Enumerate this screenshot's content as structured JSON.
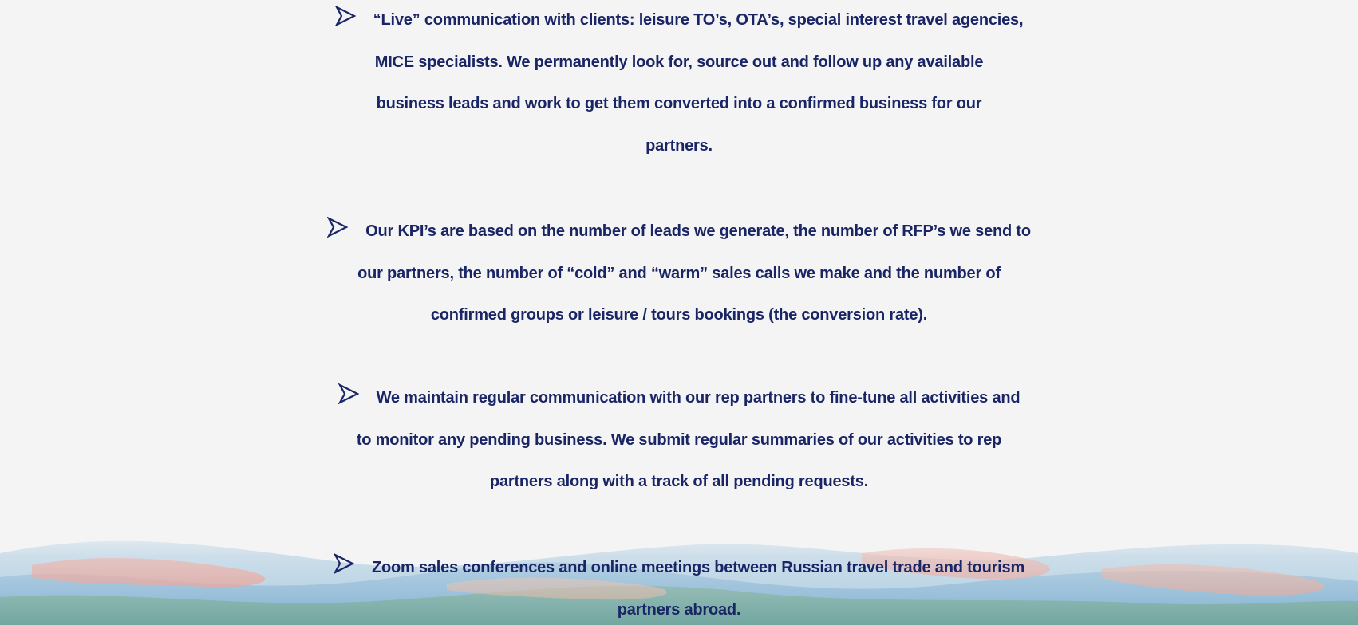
{
  "colors": {
    "text": "#1a2566",
    "background": "#f4f4f4"
  },
  "bullet_icon": "arrowhead-bullet-icon",
  "bullets": [
    {
      "lines": [
        "“Live” communication with clients: leisure TO’s, OTA’s, special interest travel agencies,",
        "MICE specialists. We permanently look for, source out and follow up any available",
        "business leads and work to get them converted into a confirmed business for our",
        "partners."
      ]
    },
    {
      "lines": [
        "Our KPI’s are based on the number of leads we generate, the number of RFP’s we send to",
        "our partners, the number of “cold” and “warm” sales calls we make and the number of",
        "confirmed groups or leisure / tours bookings (the conversion rate)."
      ]
    },
    {
      "lines": [
        "We maintain regular communication with our rep partners to fine-tune all activities and",
        "to monitor any pending business. We submit regular summaries of our activities to rep",
        "partners along with a track of all pending requests."
      ]
    },
    {
      "lines": [
        "Zoom sales conferences and online meetings between Russian travel trade and tourism",
        "partners abroad."
      ]
    }
  ]
}
